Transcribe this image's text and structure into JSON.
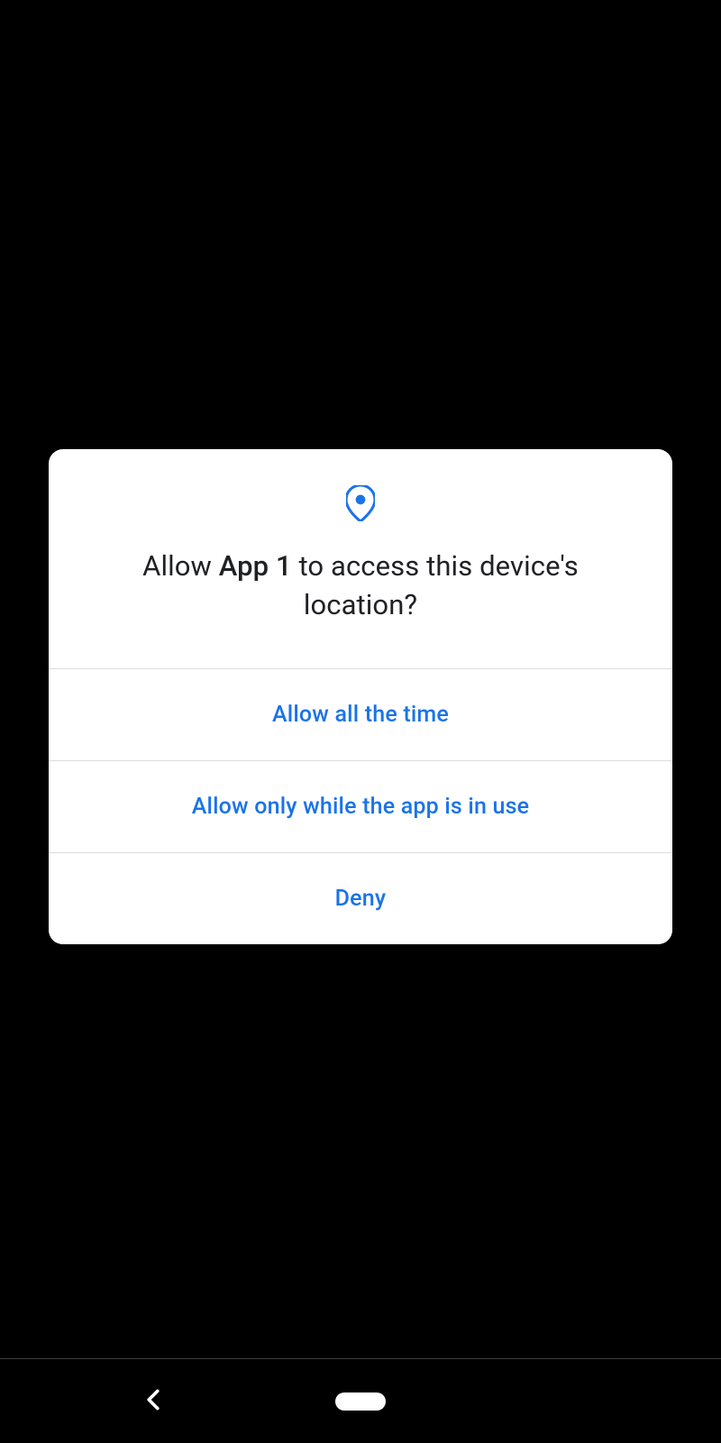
{
  "dialog": {
    "title_prefix": "Allow ",
    "app_name": "App 1",
    "title_suffix": " to access this device's location?",
    "options": {
      "allow_all": "Allow all the time",
      "allow_while_use": "Allow only while the app is in use",
      "deny": "Deny"
    }
  },
  "colors": {
    "accent": "#1a73e8",
    "text": "#202124",
    "divider": "#dadce0"
  }
}
